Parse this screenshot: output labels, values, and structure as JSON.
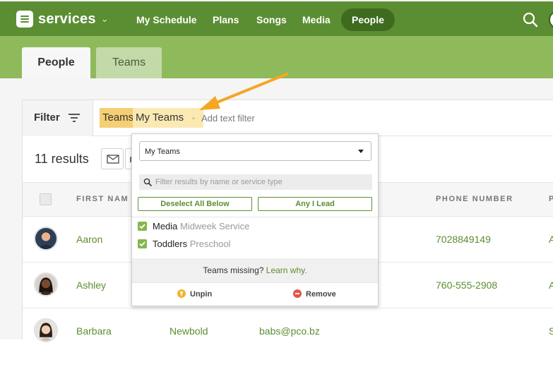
{
  "app": {
    "name": "services",
    "brand_color": "#5b8e32"
  },
  "nav": {
    "items": [
      {
        "label": "My Schedule"
      },
      {
        "label": "Plans"
      },
      {
        "label": "Songs"
      },
      {
        "label": "Media"
      },
      {
        "label": "People",
        "active": true
      }
    ],
    "search_icon": "search-icon"
  },
  "tabs": [
    {
      "label": "People",
      "active": true
    },
    {
      "label": "Teams",
      "active": false
    }
  ],
  "filter": {
    "label": "Filter",
    "chip_key": "Teams",
    "chip_value": "My Teams",
    "text_filter_placeholder": "Add text filter"
  },
  "results": {
    "count_text": "11 results"
  },
  "table": {
    "headers": [
      "FIRST NAM",
      "PHONE NUMBER",
      "P"
    ],
    "rows": [
      {
        "first": "Aaron",
        "last": "",
        "email": "",
        "phone": "7028849149",
        "extra": "A"
      },
      {
        "first": "Ashley",
        "last": "",
        "email": "",
        "phone": "760-555-2908",
        "extra": "A"
      },
      {
        "first": "Barbara",
        "last": "Newbold",
        "email": "babs@pco.bz",
        "phone": "",
        "extra": "S"
      }
    ]
  },
  "dropdown": {
    "select_value": "My Teams",
    "search_placeholder": "Filter results by name or service type",
    "deselect_label": "Deselect All Below",
    "any_label": "Any I Lead",
    "items": [
      {
        "name": "Media",
        "service": "Midweek Service",
        "checked": true
      },
      {
        "name": "Toddlers",
        "service": "Preschool",
        "checked": true
      }
    ],
    "missing_text": "Teams missing?",
    "missing_link": "Learn why.",
    "unpin_label": "Unpin",
    "remove_label": "Remove"
  },
  "colors": {
    "nav_bg": "#5b8e32",
    "tab_band": "#8fba5c",
    "chip_key": "#f4cf73",
    "chip_value": "#fbe9b4",
    "arrow": "#f5a623",
    "remove": "#e0554a",
    "unpin": "#f0b429"
  }
}
